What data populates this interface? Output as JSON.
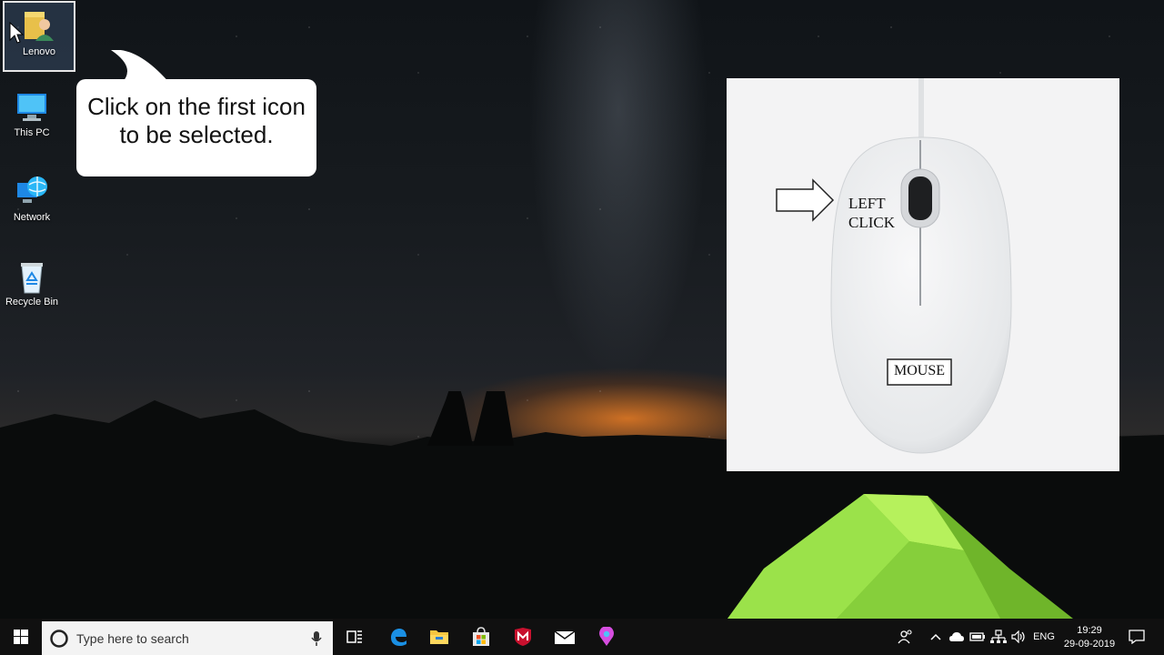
{
  "desktop": {
    "icons": [
      {
        "label": "Lenovo",
        "icon": "user-folder-icon",
        "selected": true
      },
      {
        "label": "This PC",
        "icon": "computer-icon",
        "selected": false
      },
      {
        "label": "Network",
        "icon": "network-icon",
        "selected": false
      },
      {
        "label": "Recycle Bin",
        "icon": "recycle-bin-icon",
        "selected": false
      }
    ],
    "callout": {
      "text": "Click on the first icon to be selected."
    },
    "mouse_diagram": {
      "left_click_line1": "LEFT",
      "left_click_line2": "CLICK",
      "mouse_label": "MOUSE"
    }
  },
  "taskbar": {
    "start_icon": "windows-logo-icon",
    "search": {
      "placeholder": "Type here to search"
    },
    "pinned": [
      "task-view-icon",
      "edge-icon",
      "file-explorer-icon",
      "store-icon",
      "mcafee-icon",
      "mail-icon",
      "maps-pin-icon"
    ],
    "tray": {
      "language": "ENG",
      "time": "19:29",
      "date": "29-09-2019"
    }
  },
  "colors": {
    "taskbar": "#101010",
    "accent": "#0078d7",
    "tent": "#8fd43a"
  }
}
